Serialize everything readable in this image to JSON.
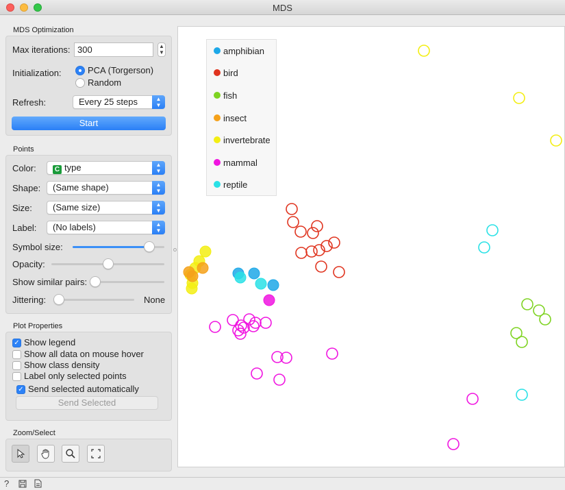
{
  "window": {
    "title": "MDS"
  },
  "optimization": {
    "section_title": "MDS Optimization",
    "max_iter_label": "Max iterations:",
    "max_iter_value": "300",
    "init_label": "Initialization:",
    "init_options": [
      "PCA (Torgerson)",
      "Random"
    ],
    "init_selected": "PCA (Torgerson)",
    "refresh_label": "Refresh:",
    "refresh_value": "Every 25 steps",
    "start_label": "Start"
  },
  "points": {
    "section_title": "Points",
    "color_label": "Color:",
    "color_badge": "C",
    "color_value": "type",
    "shape_label": "Shape:",
    "shape_value": "(Same shape)",
    "size_label": "Size:",
    "size_value": "(Same size)",
    "label_label": "Label:",
    "label_value": "(No labels)",
    "symbol_size_label": "Symbol size:",
    "symbol_size_level": 0.88,
    "opacity_label": "Opacity:",
    "opacity_level": 0.5,
    "similar_pairs_label": "Show similar pairs:",
    "similar_pairs_level": 0.0,
    "jittering_label": "Jittering:",
    "jittering_level": 0.0,
    "jittering_value": "None"
  },
  "plot_properties": {
    "section_title": "Plot Properties",
    "show_legend": {
      "label": "Show legend",
      "checked": true
    },
    "show_all_data": {
      "label": "Show all data on mouse hover",
      "checked": false
    },
    "class_density": {
      "label": "Show class density",
      "checked": false
    },
    "label_selected": {
      "label": "Label only selected points",
      "checked": false
    },
    "send_auto": {
      "label": "Send selected automatically",
      "checked": true
    },
    "send_button": "Send Selected"
  },
  "zoom_select": {
    "section_title": "Zoom/Select",
    "tools": [
      "pointer-icon",
      "pan-hand-icon",
      "zoom-magnifier-icon",
      "zoom-reset-icon"
    ]
  },
  "legend": {
    "items": [
      {
        "label": "amphibian",
        "color": "#1da8e8"
      },
      {
        "label": "bird",
        "color": "#e0341f"
      },
      {
        "label": "fish",
        "color": "#7ed321"
      },
      {
        "label": "insect",
        "color": "#f5a11a"
      },
      {
        "label": "invertebrate",
        "color": "#f3ee13"
      },
      {
        "label": "mammal",
        "color": "#f015e0"
      },
      {
        "label": "reptile",
        "color": "#2ae1e6"
      }
    ]
  },
  "status_icons": [
    "help-icon",
    "save-icon",
    "report-icon"
  ]
}
